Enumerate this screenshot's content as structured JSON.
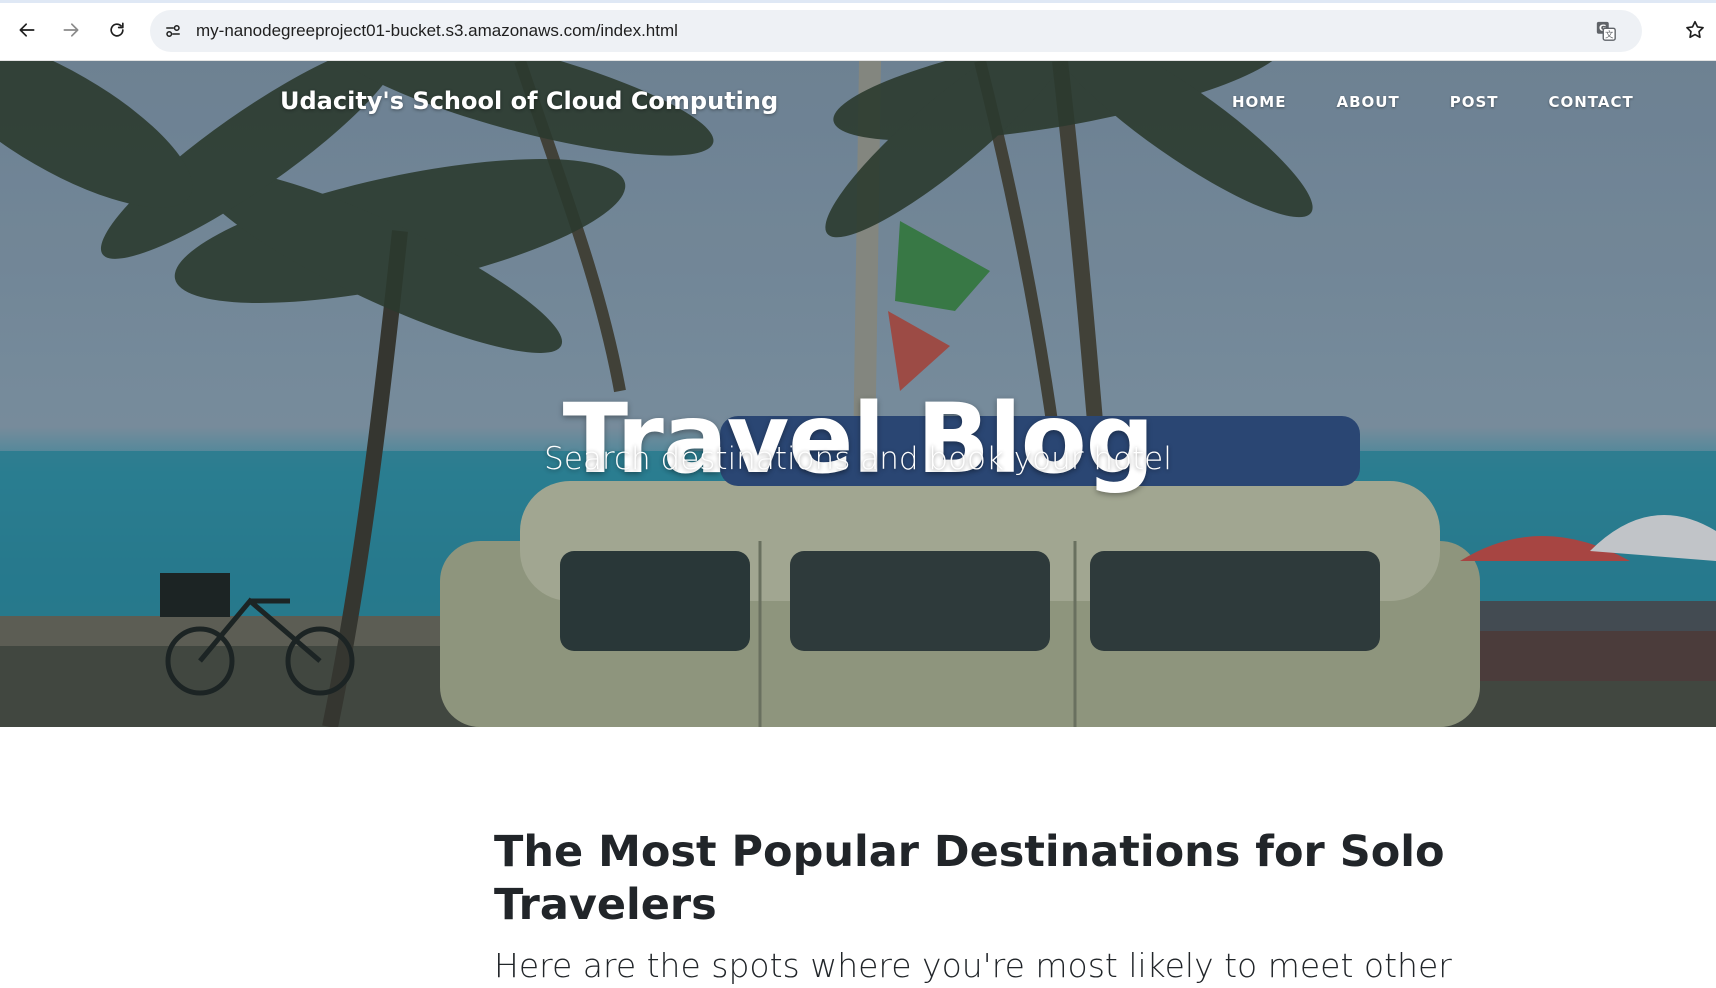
{
  "browser": {
    "url": "my-nanodegreeproject01-bucket.s3.amazonaws.com/index.html",
    "icons": [
      "back-arrow-icon",
      "forward-arrow-icon",
      "reload-icon",
      "site-info-icon",
      "translate-icon",
      "star-icon"
    ]
  },
  "header": {
    "brand": "Udacity's School of Cloud Computing",
    "nav": [
      "HOME",
      "ABOUT",
      "POST",
      "CONTACT"
    ]
  },
  "hero": {
    "title": "Travel Blog",
    "subtitle": "Search destinations and book your hotel"
  },
  "post": {
    "title": "The Most Popular Destinations for Solo Travelers",
    "subtitle": "Here are the spots where you're most likely to meet other"
  },
  "colors": {
    "text_dark": "#212529",
    "hero_text": "#ffffff",
    "omnibox_bg": "#eef1f5"
  }
}
